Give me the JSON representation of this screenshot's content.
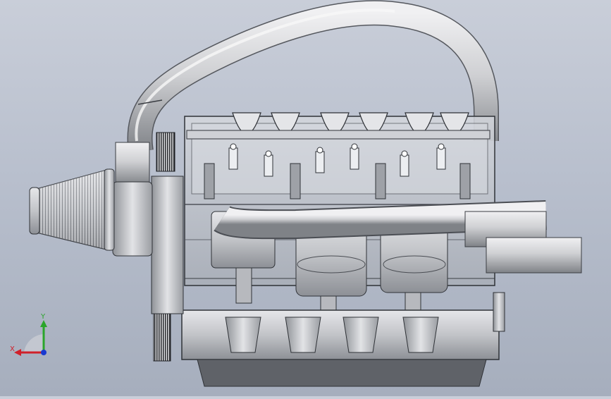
{
  "viewport": {
    "background_top": "#c9ced9",
    "background_bottom": "#a6aebd",
    "model": "engine-assembly"
  },
  "triad": {
    "x_label": "X",
    "y_label": "Y",
    "x_color": "#d0202a",
    "y_color": "#2aa52a",
    "z_color": "#1a3ad0"
  }
}
